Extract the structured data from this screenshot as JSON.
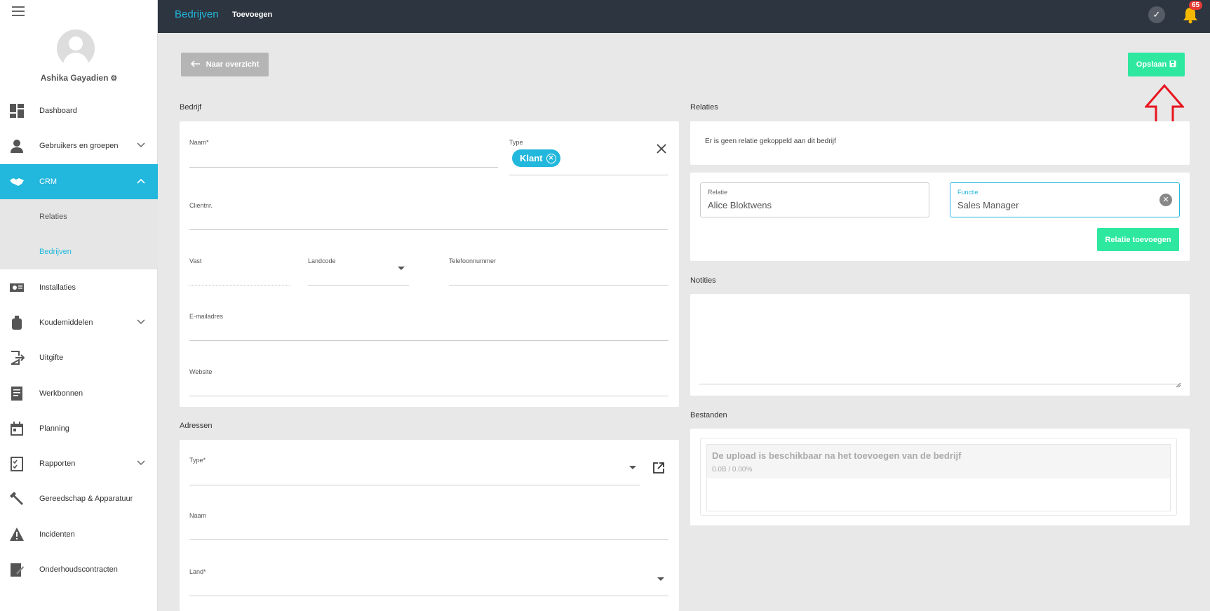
{
  "sidebar": {
    "user_name": "Ashika Gayadien",
    "items": [
      {
        "label": "Dashboard",
        "icon": "dashboard-icon",
        "chevron": ""
      },
      {
        "label": "Gebruikers en groepen",
        "icon": "user-icon",
        "chevron": "⌄"
      },
      {
        "label": "CRM",
        "icon": "handshake-icon",
        "chevron": "⌃"
      },
      {
        "label": "Relaties",
        "icon": "",
        "chevron": ""
      },
      {
        "label": "Bedrijven",
        "icon": "",
        "chevron": ""
      },
      {
        "label": "Installaties",
        "icon": "installation-icon",
        "chevron": ""
      },
      {
        "label": "Koudemiddelen",
        "icon": "gas-cylinder-icon",
        "chevron": "⌄"
      },
      {
        "label": "Uitgifte",
        "icon": "exit-icon",
        "chevron": ""
      },
      {
        "label": "Werkbonnen",
        "icon": "document-icon",
        "chevron": ""
      },
      {
        "label": "Planning",
        "icon": "calendar-icon",
        "chevron": ""
      },
      {
        "label": "Rapporten",
        "icon": "report-icon",
        "chevron": "⌄"
      },
      {
        "label": "Gereedschap & Apparatuur",
        "icon": "wrench-icon",
        "chevron": ""
      },
      {
        "label": "Incidenten",
        "icon": "warning-icon",
        "chevron": ""
      },
      {
        "label": "Onderhoudscontracten",
        "icon": "contract-icon",
        "chevron": ""
      }
    ]
  },
  "topbar": {
    "crumb_section": "Bedrijven",
    "crumb_page": "Toevoegen",
    "notification_count": "65"
  },
  "actions": {
    "back_label": "Naar overzicht",
    "save_label": "Opslaan"
  },
  "bedrijf": {
    "title": "Bedrijf",
    "naam_label": "Naam*",
    "type_label": "Type",
    "type_chip": "Klant",
    "clientnr_label": "Clientnr.",
    "vast_label": "Vast",
    "landcode_label": "Landcode",
    "telefoon_label": "Telefoonnummer",
    "email_label": "E-mailadres",
    "website_label": "Website"
  },
  "adressen": {
    "title": "Adressen",
    "type_label": "Type*",
    "naam_label": "Naam",
    "land_label": "Land*"
  },
  "relaties": {
    "title": "Relaties",
    "empty_text": "Er is geen relatie gekoppeld aan dit bedrijf",
    "relatie_label": "Relatie",
    "relatie_value": "Alice Bloktwens",
    "functie_label": "Functie",
    "functie_value": "Sales Manager",
    "add_button": "Relatie toevoegen"
  },
  "notities": {
    "title": "Notities"
  },
  "bestanden": {
    "title": "Bestanden",
    "upload_text": "De upload is beschikbaar na het toevoegen van de bedrijf",
    "upload_progress": "0.0B / 0.00%"
  },
  "colors": {
    "accent": "#22b7dc",
    "success": "#2ee8a0",
    "topbar": "#2d3540",
    "annotation": "#e8141e"
  }
}
